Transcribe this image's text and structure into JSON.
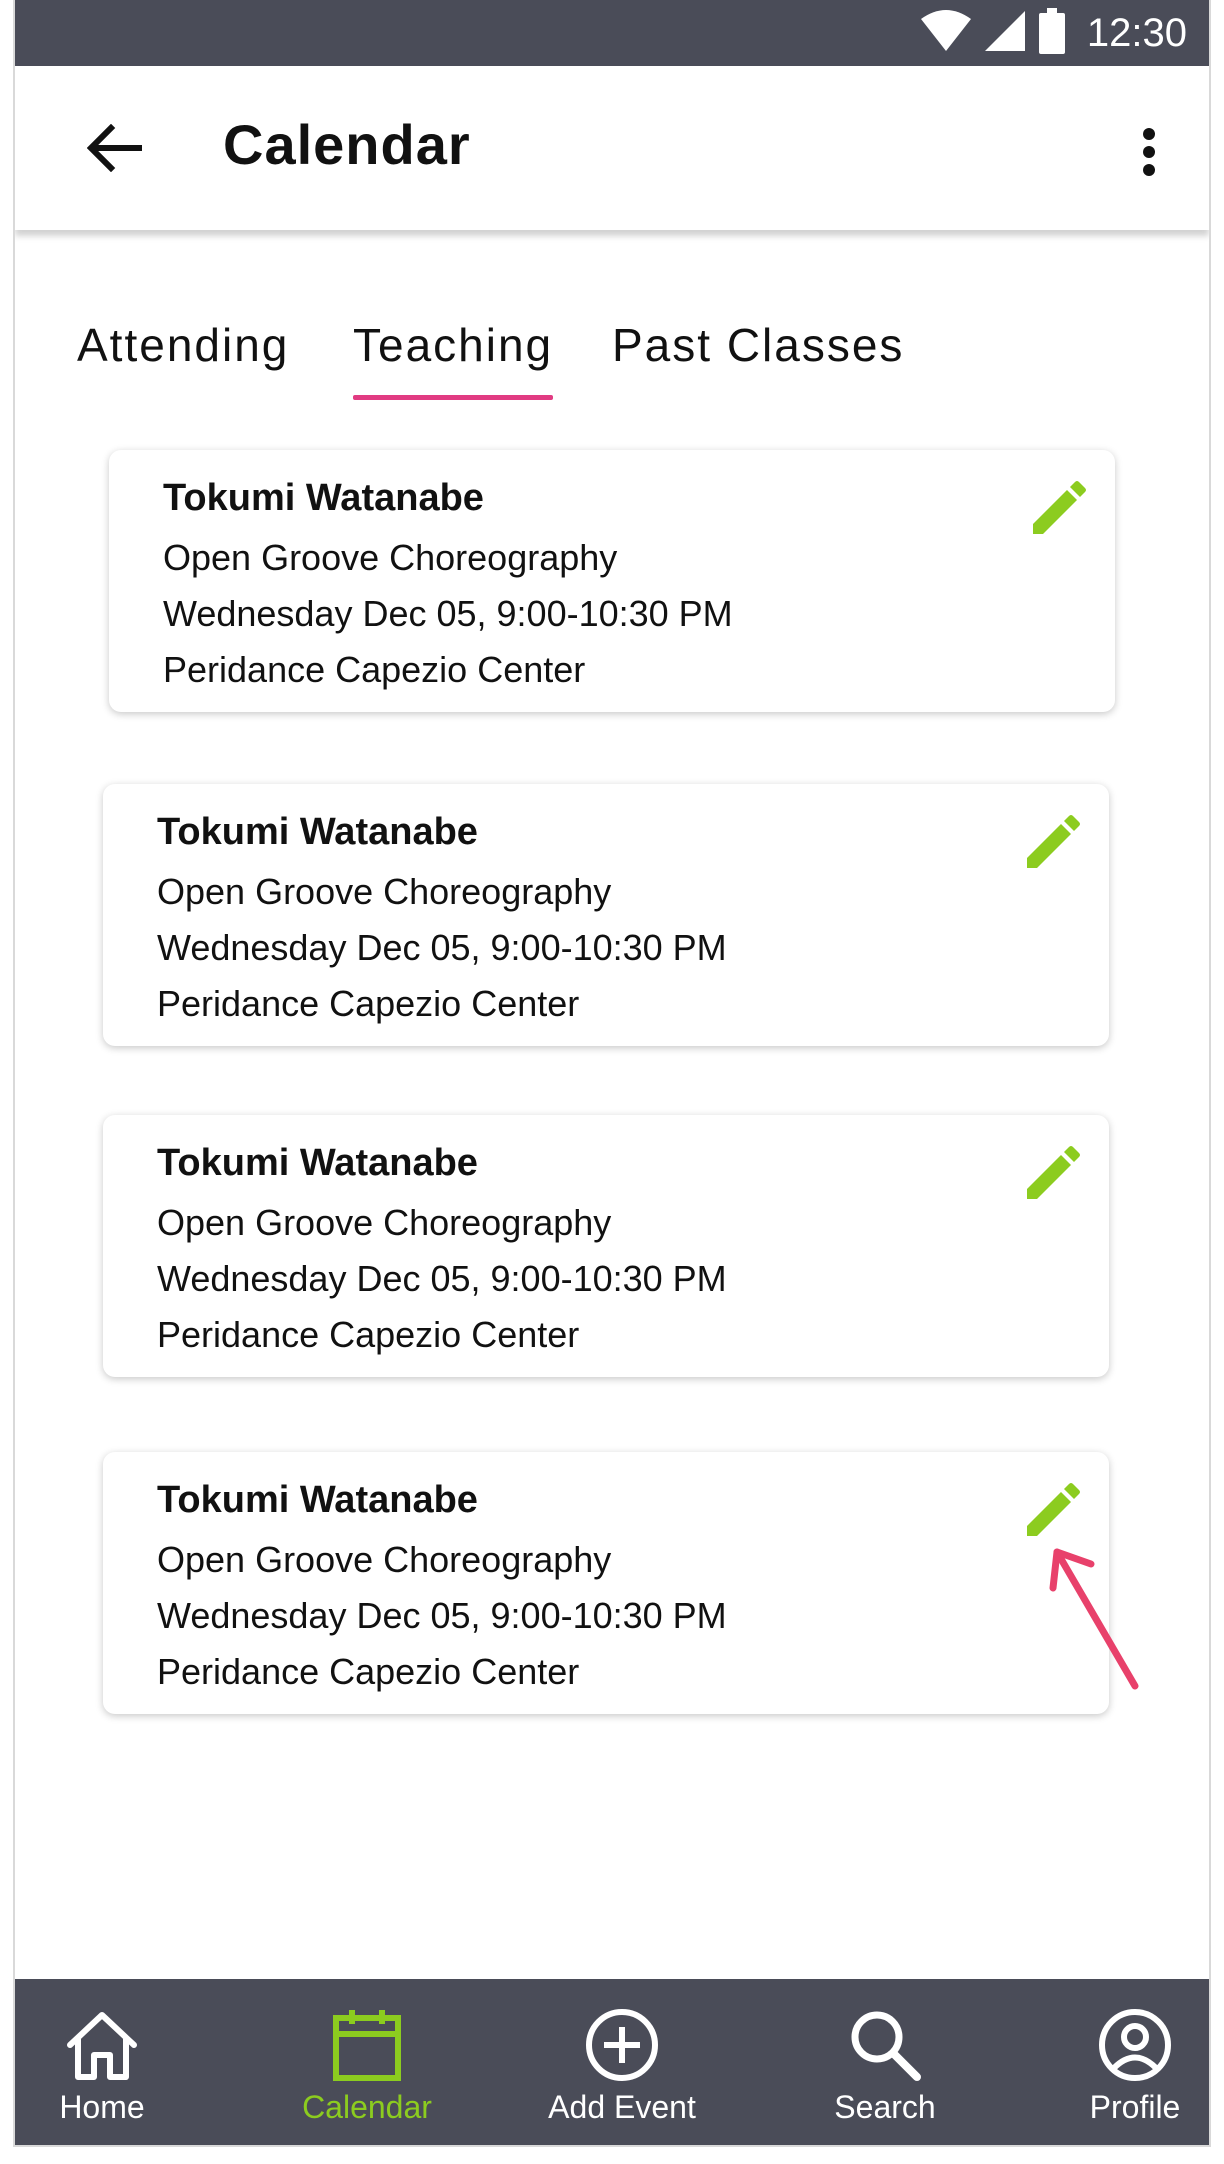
{
  "status_bar": {
    "time": "12:30"
  },
  "app_bar": {
    "title": "Calendar"
  },
  "tabs": [
    {
      "label": "Attending",
      "active": false
    },
    {
      "label": "Teaching",
      "active": true
    },
    {
      "label": "Past Classes",
      "active": false
    }
  ],
  "events": [
    {
      "name": "Tokumi Watanabe",
      "class": "Open Groove Choreography",
      "when": "Wednesday Dec 05, 9:00-10:30 PM",
      "where": "Peridance Capezio Center"
    },
    {
      "name": "Tokumi Watanabe",
      "class": "Open Groove Choreography",
      "when": "Wednesday Dec 05, 9:00-10:30 PM",
      "where": "Peridance Capezio Center"
    },
    {
      "name": "Tokumi Watanabe",
      "class": "Open Groove Choreography",
      "when": "Wednesday Dec 05, 9:00-10:30 PM",
      "where": "Peridance Capezio Center"
    },
    {
      "name": "Tokumi Watanabe",
      "class": "Open Groove Choreography",
      "when": "Wednesday Dec 05, 9:00-10:30 PM",
      "where": "Peridance Capezio Center"
    }
  ],
  "bottom_nav": [
    {
      "label": "Home",
      "icon": "home-icon",
      "active": false
    },
    {
      "label": "Calendar",
      "icon": "calendar-icon",
      "active": true
    },
    {
      "label": "Add Event",
      "icon": "add-circle-icon",
      "active": false
    },
    {
      "label": "Search",
      "icon": "search-icon",
      "active": false
    },
    {
      "label": "Profile",
      "icon": "profile-icon",
      "active": false
    }
  ],
  "colors": {
    "bar_background": "#4a4c58",
    "tab_indicator": "#e13b82",
    "accent_green": "#8ccc1f",
    "annotation_arrow": "#e8416b"
  }
}
